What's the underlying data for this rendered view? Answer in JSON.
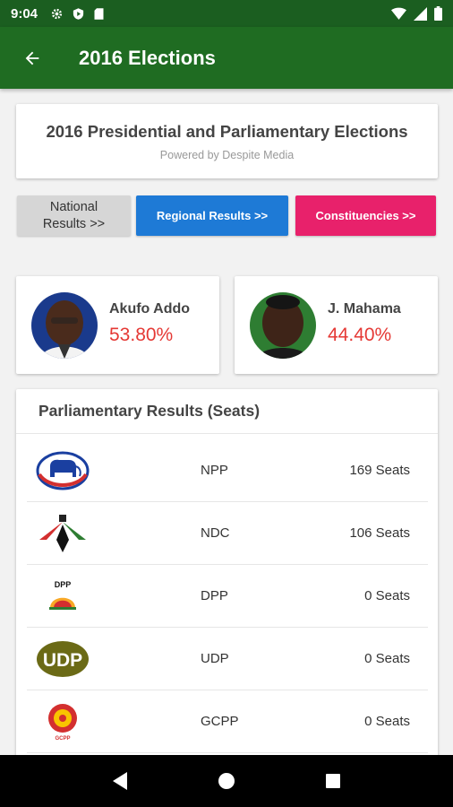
{
  "status_bar": {
    "time": "9:04"
  },
  "app_bar": {
    "title": "2016 Elections"
  },
  "header": {
    "title": "2016 Presidential and Parliamentary Elections",
    "subtitle": "Powered by Despite Media"
  },
  "buttons": {
    "national_line1": "National",
    "national_line2": "Results >>",
    "regional": "Regional Results >>",
    "constituencies": "Constituencies >>"
  },
  "candidates": [
    {
      "name": "Akufo Addo",
      "percent": "53.80%"
    },
    {
      "name": "J. Mahama",
      "percent": "44.40%"
    }
  ],
  "parliament": {
    "title": "Parliamentary Results (Seats)",
    "parties": [
      {
        "name": "NPP",
        "seats": "169 Seats"
      },
      {
        "name": "NDC",
        "seats": "106 Seats"
      },
      {
        "name": "DPP",
        "seats": "0 Seats",
        "logo_text": "DPP"
      },
      {
        "name": "UDP",
        "seats": "0 Seats",
        "logo_text": "UDP"
      },
      {
        "name": "GCPP",
        "seats": "0 Seats",
        "logo_text": "GCPP"
      }
    ]
  },
  "colors": {
    "app_bar": "#1f6c22",
    "regional_button": "#1e7ad6",
    "constituencies_button": "#e8216b",
    "percent_text": "#e53935"
  }
}
